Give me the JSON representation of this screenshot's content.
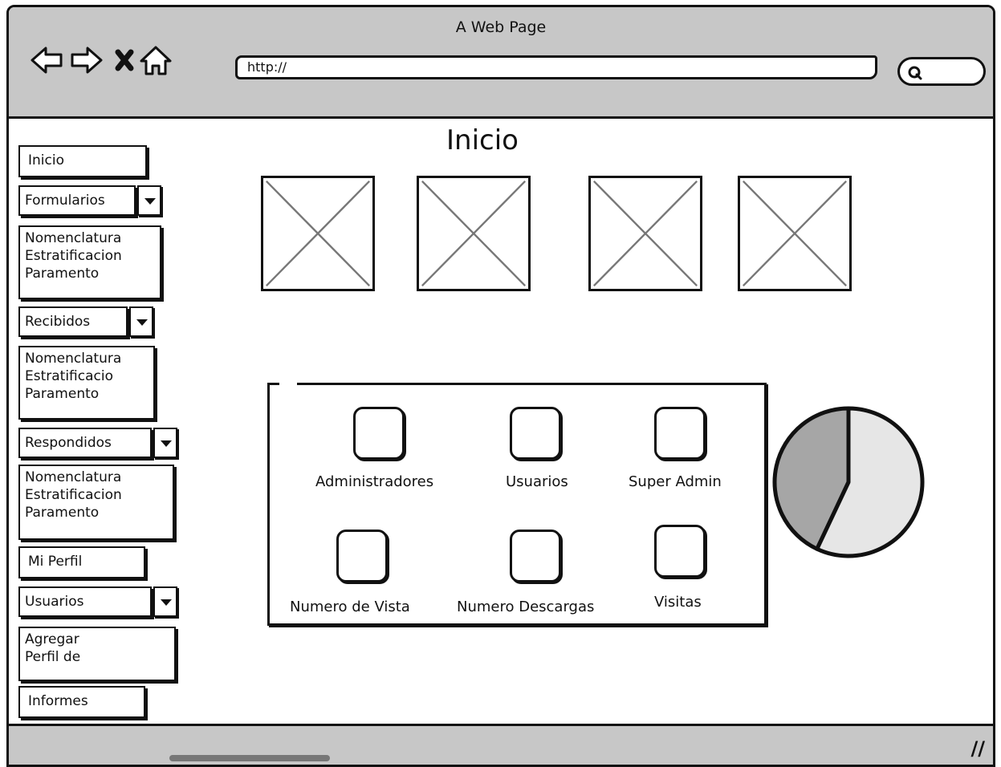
{
  "window": {
    "title": "A Web Page"
  },
  "toolbar": {
    "address_value": "http://",
    "search_placeholder": ""
  },
  "sidebar": {
    "inicio": "Inicio",
    "formularios": {
      "label": "Formularios",
      "items": [
        "Nomenclatura",
        "Estratificacion",
        "Paramento"
      ]
    },
    "recibidos": {
      "label": "Recibidos",
      "items": [
        "Nomenclatura",
        "Estratificacio",
        "Paramento"
      ]
    },
    "respondidos": {
      "label": "Respondidos",
      "items": [
        "Nomenclatura",
        "Estratificacion",
        "Paramento"
      ]
    },
    "mi_perfil": "Mi Perfil",
    "usuarios": {
      "label": "Usuarios",
      "items": [
        "Agregar",
        "Perfil de"
      ]
    },
    "informes": "Informes"
  },
  "main": {
    "title": "Inicio",
    "stats": [
      "Administradores",
      "Usuarios",
      "Super Admin",
      "Numero de Vista",
      "Numero Descargas",
      "Visitas"
    ]
  },
  "chart_data": {
    "type": "pie",
    "values": [
      43,
      57
    ],
    "colors": [
      "#a6a6a6",
      "#e6e6e6"
    ]
  }
}
